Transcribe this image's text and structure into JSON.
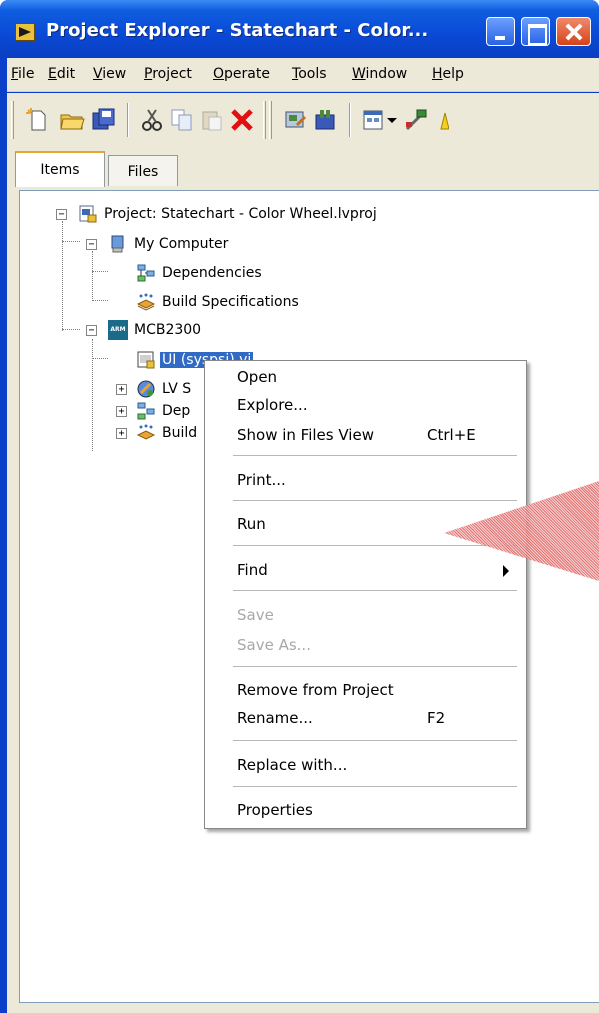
{
  "window": {
    "title": "Project Explorer - Statechart - Color...",
    "colors": {
      "titlebar": "#0a49d6",
      "selection": "#316ac5",
      "annotation": "#e06666"
    }
  },
  "menubar": {
    "items": [
      {
        "label": "File",
        "mnemonic": "F"
      },
      {
        "label": "Edit",
        "mnemonic": "E"
      },
      {
        "label": "View",
        "mnemonic": "V"
      },
      {
        "label": "Project",
        "mnemonic": "P"
      },
      {
        "label": "Operate",
        "mnemonic": "O"
      },
      {
        "label": "Tools",
        "mnemonic": "T"
      },
      {
        "label": "Window",
        "mnemonic": "W"
      },
      {
        "label": "Help",
        "mnemonic": "H"
      }
    ]
  },
  "toolbar": {
    "icons": [
      "new-icon",
      "open-folder-icon",
      "save-all-icon",
      "cut-icon",
      "copy-icon",
      "paste-icon",
      "delete-icon",
      "build-icon",
      "deploy-icon",
      "view-icon",
      "dropdown-arrow-icon",
      "wand-icon",
      "warning-icon"
    ]
  },
  "tabs": [
    {
      "label": "Items",
      "active": true
    },
    {
      "label": "Files",
      "active": false
    }
  ],
  "tree": {
    "project": "Project: Statechart - Color Wheel.lvproj",
    "my_computer": "My Computer",
    "dependencies_1": "Dependencies",
    "build_specs_1": "Build Specifications",
    "target_badge": "ARM",
    "target": "MCB2300",
    "selected_item": "UI (syspsi).vi",
    "lv_item": "LV S",
    "dep_item": "Dep",
    "build_item": "Build"
  },
  "context_menu": {
    "items": [
      {
        "label": "Open"
      },
      {
        "label": "Explore..."
      },
      {
        "label": "Show in Files View",
        "shortcut": "Ctrl+E"
      },
      {
        "label": "Print..."
      },
      {
        "label": "Run"
      },
      {
        "label": "Find",
        "submenu": true
      },
      {
        "label": "Save",
        "disabled": true
      },
      {
        "label": "Save As...",
        "disabled": true
      },
      {
        "label": "Remove from Project"
      },
      {
        "label": "Rename...",
        "shortcut": "F2"
      },
      {
        "label": "Replace with..."
      },
      {
        "label": "Properties"
      }
    ]
  }
}
